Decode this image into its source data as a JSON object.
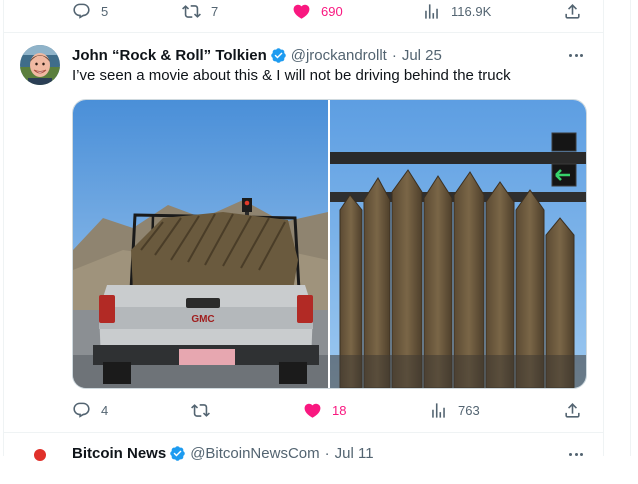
{
  "prev_tweet": {
    "replies": "5",
    "reposts": "7",
    "likes": "690",
    "views": "116.9K"
  },
  "tweet": {
    "display_name": "John “Rock & Roll” Tolkien",
    "handle": "@jrockandrollt",
    "separator": "·",
    "date": "Jul 25",
    "text": "I’ve seen a movie about this & I will not be driving behind the truck",
    "stats": {
      "replies": "4",
      "reposts": "",
      "likes": "18",
      "views": "763"
    },
    "media": [
      "pickup-truck-with-wooden-stakes-photo",
      "close-up-sharpened-wooden-stakes-photo"
    ]
  },
  "next_tweet": {
    "display_name": "Bitcoin News",
    "handle": "@BitcoinNewsCom",
    "separator": "·",
    "date": "Jul 11"
  },
  "colors": {
    "text_primary": "#0f1419",
    "text_secondary": "#536471",
    "like_pink": "#f91880",
    "verified_blue": "#1d9bf0",
    "border": "#eff3f4"
  },
  "icons": [
    "reply-icon",
    "repost-icon",
    "heart-icon",
    "views-icon",
    "share-icon",
    "verified-badge-icon",
    "more-icon"
  ]
}
